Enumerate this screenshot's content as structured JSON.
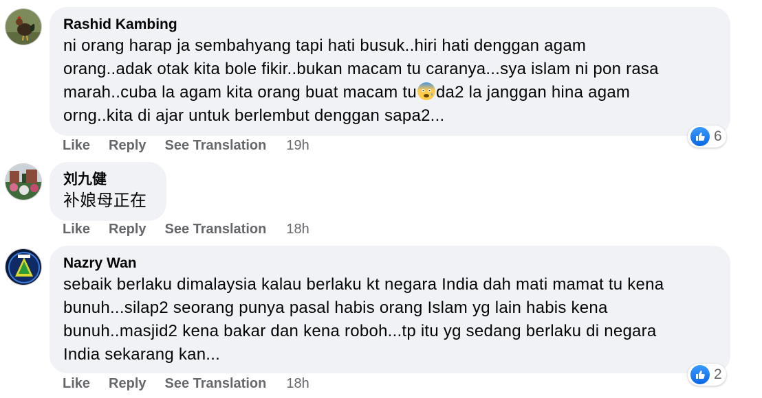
{
  "comments": [
    {
      "author": "Rashid Kambing",
      "avatar_icon": "rooster-avatar-icon",
      "text_before_emoji": "ni orang harap ja sembahyang tapi hati busuk..hiri hati denggan agam\norang..adak otak kita bole fikir..bukan macam tu caranya...sya islam ni pon rasa\nmarah..cuba la agam kita orang buat macam tu",
      "emoji": "anxious-face-emoji",
      "text_after_emoji": "da2 la janggan hina agam\norng..kita di ajar untuk berlembut denggan sapa2...",
      "like": "Like",
      "reply": "Reply",
      "translate": "See Translation",
      "time": "19h",
      "reaction_count": "6"
    },
    {
      "author": "刘九健",
      "avatar_icon": "garden-avatar-icon",
      "text": "补娘母正在",
      "like": "Like",
      "reply": "Reply",
      "translate": "See Translation",
      "time": "18h"
    },
    {
      "author": "Nazry Wan",
      "avatar_icon": "emblem-avatar-icon",
      "text": "sebaik berlaku dimalaysia kalau berlaku kt negara India dah mati mamat tu kena\nbunuh...silap2 seorang punya pasal habis orang Islam yg lain habis kena\nbunuh..masjid2 kena bakar dan kena roboh...tp itu yg sedang berlaku di negara\nIndia sekarang kan...",
      "like": "Like",
      "reply": "Reply",
      "translate": "See Translation",
      "time": "18h",
      "reaction_count": "2"
    }
  ],
  "colors": {
    "bubble": "#f0f2f5",
    "meta": "#65676b",
    "like_blue": "#1877f2"
  }
}
